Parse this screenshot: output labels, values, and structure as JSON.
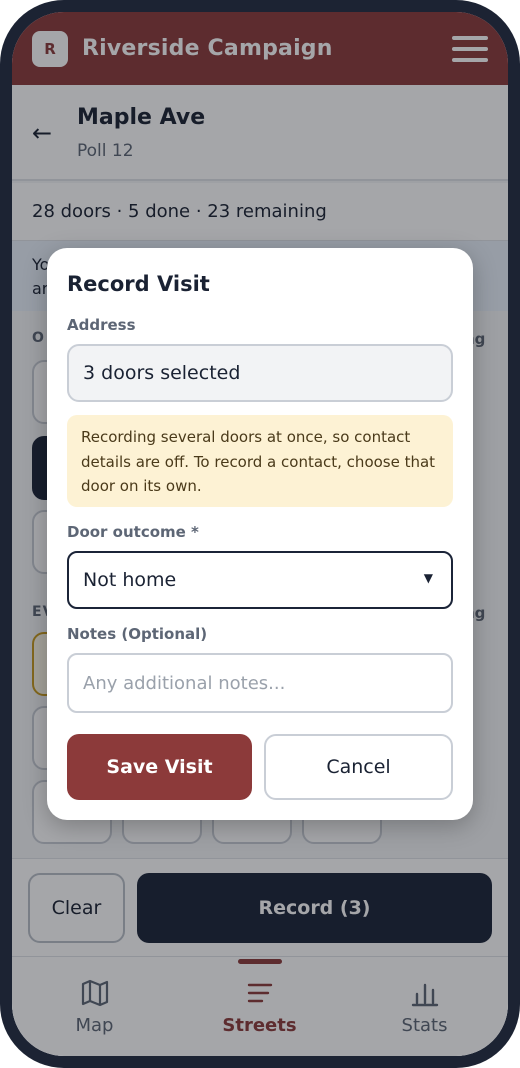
{
  "app": {
    "logo_letter": "R",
    "title": "Riverside Campaign"
  },
  "street": {
    "name": "Maple Ave",
    "poll": "Poll 12"
  },
  "door_stats": "28 doors · 5 done · 23 remaining",
  "background_sections": {
    "info_banner_fragment": "Yo\nar",
    "section_1_label_fragment": "O",
    "section_1_right_fragment": "ng",
    "section_2_label_fragment": "EV",
    "section_2_right_fragment": "ng"
  },
  "modal": {
    "title": "Record Visit",
    "address_label": "Address",
    "address_value": "3 doors selected",
    "warning": "Recording several doors at once, so contact details are off. To record a contact, choose that door on its own.",
    "outcome_label": "Door outcome *",
    "outcome_value": "Not home",
    "notes_label": "Notes (Optional)",
    "notes_placeholder": "Any additional notes...",
    "save_label": "Save Visit",
    "cancel_label": "Cancel"
  },
  "actions": {
    "clear_label": "Clear",
    "record_label": "Record (3)"
  },
  "nav": {
    "items": [
      {
        "label": "Map",
        "icon": "map-icon",
        "active": false
      },
      {
        "label": "Streets",
        "icon": "list-icon",
        "active": true
      },
      {
        "label": "Stats",
        "icon": "bar-chart-icon",
        "active": false
      }
    ]
  },
  "colors": {
    "brand": "#8c3a3a",
    "dark": "#1b2438",
    "warning_bg": "#fdf2d4",
    "info_bg": "#e8f0fb"
  }
}
